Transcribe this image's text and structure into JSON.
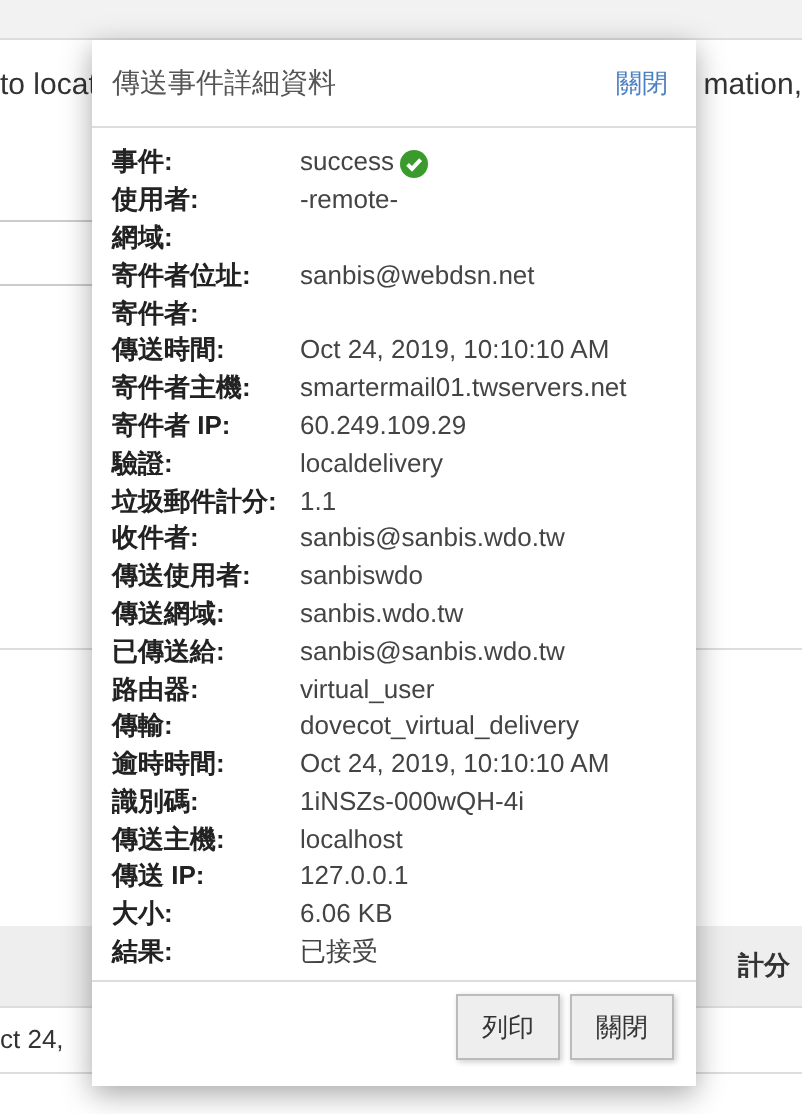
{
  "background": {
    "intro_left": "to locat",
    "intro_right": "mation,",
    "table_header_right": "計分",
    "table_cell": "ct 24,"
  },
  "dialog": {
    "title": "傳送事件詳細資料",
    "header_link": "關閉",
    "rows": [
      {
        "label": "事件:",
        "value": "success",
        "kind": "status"
      },
      {
        "label": "使用者:",
        "value": "-remote-",
        "kind": "text"
      },
      {
        "label": "網域:",
        "kind": "text"
      },
      {
        "label": "寄件者位址:",
        "value": "sanbis@webdsn.net",
        "kind": "text"
      },
      {
        "label": "寄件者:",
        "kind": "text"
      },
      {
        "label": "傳送時間:",
        "value": "Oct 24, 2019, 10:10:10 AM",
        "kind": "text"
      },
      {
        "label": "寄件者主機:",
        "value": "smartermail01.twservers.net",
        "kind": "text"
      },
      {
        "label": "寄件者 IP:",
        "value": "60.249.109.29",
        "kind": "text"
      },
      {
        "label": "驗證:",
        "value": "localdelivery",
        "kind": "text"
      },
      {
        "label": "垃圾郵件計分:",
        "value": "1.1",
        "kind": "text"
      },
      {
        "label": "收件者:",
        "value": "sanbis@sanbis.wdo.tw",
        "kind": "text"
      },
      {
        "label": "傳送使用者:",
        "value": "sanbiswdo",
        "kind": "text"
      },
      {
        "label": "傳送網域:",
        "value": "sanbis.wdo.tw",
        "kind": "text"
      },
      {
        "label": "已傳送給:",
        "value": "sanbis@sanbis.wdo.tw",
        "kind": "text"
      },
      {
        "label": "路由器:",
        "value": "virtual_user",
        "kind": "text"
      },
      {
        "label": "傳輸:",
        "value": "dovecot_virtual_delivery",
        "kind": "text"
      },
      {
        "label": "逾時時間:",
        "value": "Oct 24, 2019, 10:10:10 AM",
        "kind": "text"
      },
      {
        "label": "識別碼:",
        "value": "1iNSZs-000wQH-4i",
        "kind": "text"
      },
      {
        "label": "傳送主機:",
        "value": "localhost",
        "kind": "text"
      },
      {
        "label": "傳送 IP:",
        "value": "127.0.0.1",
        "kind": "text"
      },
      {
        "label": "大小:",
        "value": "6.06 KB",
        "kind": "text"
      },
      {
        "label": "結果:",
        "value": "已接受",
        "kind": "text"
      }
    ],
    "buttons": [
      "列印",
      "關閉"
    ]
  }
}
